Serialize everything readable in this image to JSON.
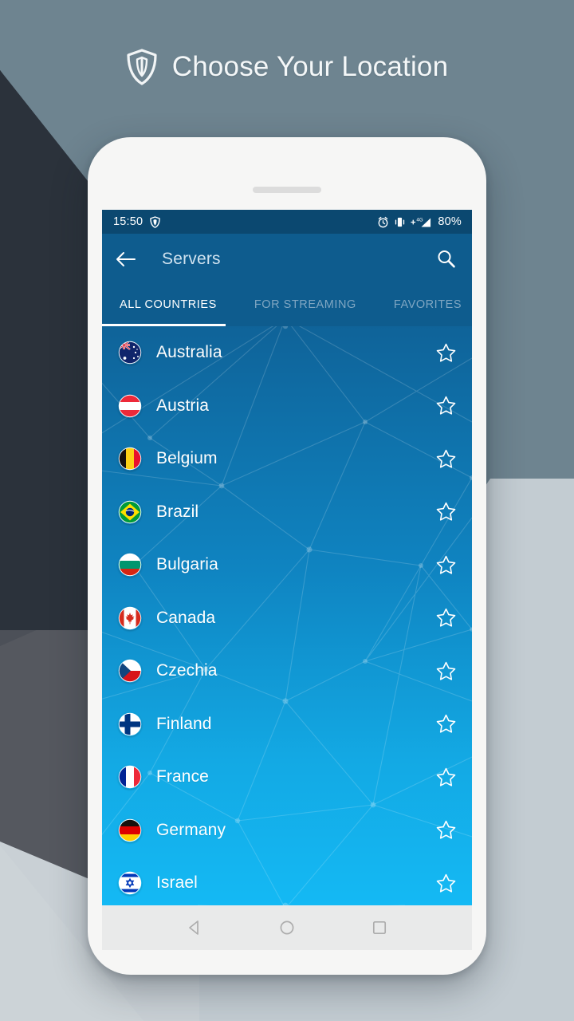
{
  "header": {
    "title": "Choose Your Location",
    "logo_icon": "shield-icon"
  },
  "colors": {
    "page_bg": "#6e8490",
    "dark_shape": "#2b323b",
    "mid_shape": "#4c5058",
    "light_shape": "#c3ccd2",
    "phone_body": "#f6f6f5",
    "status_bar": "#0b4870",
    "app_bar": "#0e5c8e",
    "tab_active": "#ffffff",
    "tab_inactive": "#7fa6c2",
    "list_gradient_top": "#0f6399",
    "list_gradient_bottom": "#14b9f4",
    "nav_bar": "#e9eaea"
  },
  "status_bar": {
    "time": "15:50",
    "shield_icon": "shield-icon",
    "alarm_icon": "alarm-clock-icon",
    "vibrate_icon": "vibrate-icon",
    "network_label": "4G",
    "signal_icon": "signal-bars-icon",
    "battery": "80%"
  },
  "app_bar": {
    "back_icon": "back-arrow-icon",
    "title": "Servers",
    "search_icon": "search-icon"
  },
  "tabs": [
    {
      "label": "ALL COUNTRIES",
      "active": true
    },
    {
      "label": "FOR STREAMING",
      "active": false
    },
    {
      "label": "FAVORITES",
      "active": false
    }
  ],
  "countries": [
    {
      "name": "Australia",
      "flag": "flag-australia",
      "favorite": false
    },
    {
      "name": "Austria",
      "flag": "flag-austria",
      "favorite": false
    },
    {
      "name": "Belgium",
      "flag": "flag-belgium",
      "favorite": false
    },
    {
      "name": "Brazil",
      "flag": "flag-brazil",
      "favorite": false
    },
    {
      "name": "Bulgaria",
      "flag": "flag-bulgaria",
      "favorite": false
    },
    {
      "name": "Canada",
      "flag": "flag-canada",
      "favorite": false
    },
    {
      "name": "Czechia",
      "flag": "flag-czechia",
      "favorite": false
    },
    {
      "name": "Finland",
      "flag": "flag-finland",
      "favorite": false
    },
    {
      "name": "France",
      "flag": "flag-france",
      "favorite": false
    },
    {
      "name": "Germany",
      "flag": "flag-germany",
      "favorite": false
    },
    {
      "name": "Israel",
      "flag": "flag-israel",
      "favorite": false
    }
  ],
  "nav_bar": {
    "back": "nav-back-icon",
    "home": "nav-home-icon",
    "recents": "nav-recents-icon"
  }
}
